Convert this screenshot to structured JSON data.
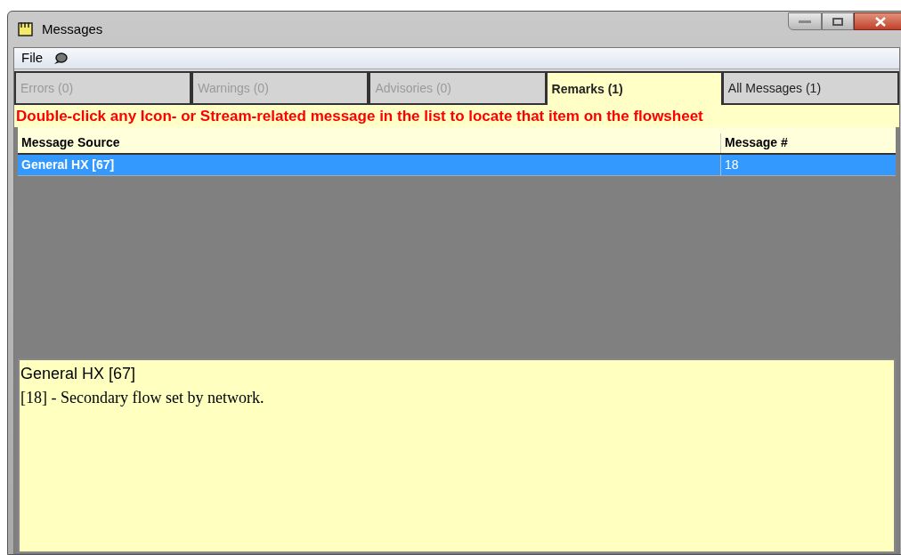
{
  "window": {
    "title": "Messages"
  },
  "menu": [
    {
      "label": "File"
    }
  ],
  "tabs": [
    {
      "label": "Errors (0)",
      "selected": false,
      "disabled": true
    },
    {
      "label": "Warnings (0)",
      "selected": false,
      "disabled": true
    },
    {
      "label": "Advisories (0)",
      "selected": false,
      "disabled": true
    },
    {
      "label": "Remarks (1)",
      "selected": true,
      "disabled": false
    },
    {
      "label": "All Messages (1)",
      "selected": false,
      "disabled": false
    }
  ],
  "hint": "Double-click any Icon- or Stream-related message in the list to locate that item on the flowsheet",
  "table": {
    "columns": [
      "Message Source",
      "Message #"
    ],
    "rows": [
      {
        "cells": [
          "General HX [67]",
          "18"
        ],
        "selected": true
      }
    ]
  },
  "detail": {
    "title": "General HX [67]",
    "text": "[18] - Secondary flow set by network."
  }
}
